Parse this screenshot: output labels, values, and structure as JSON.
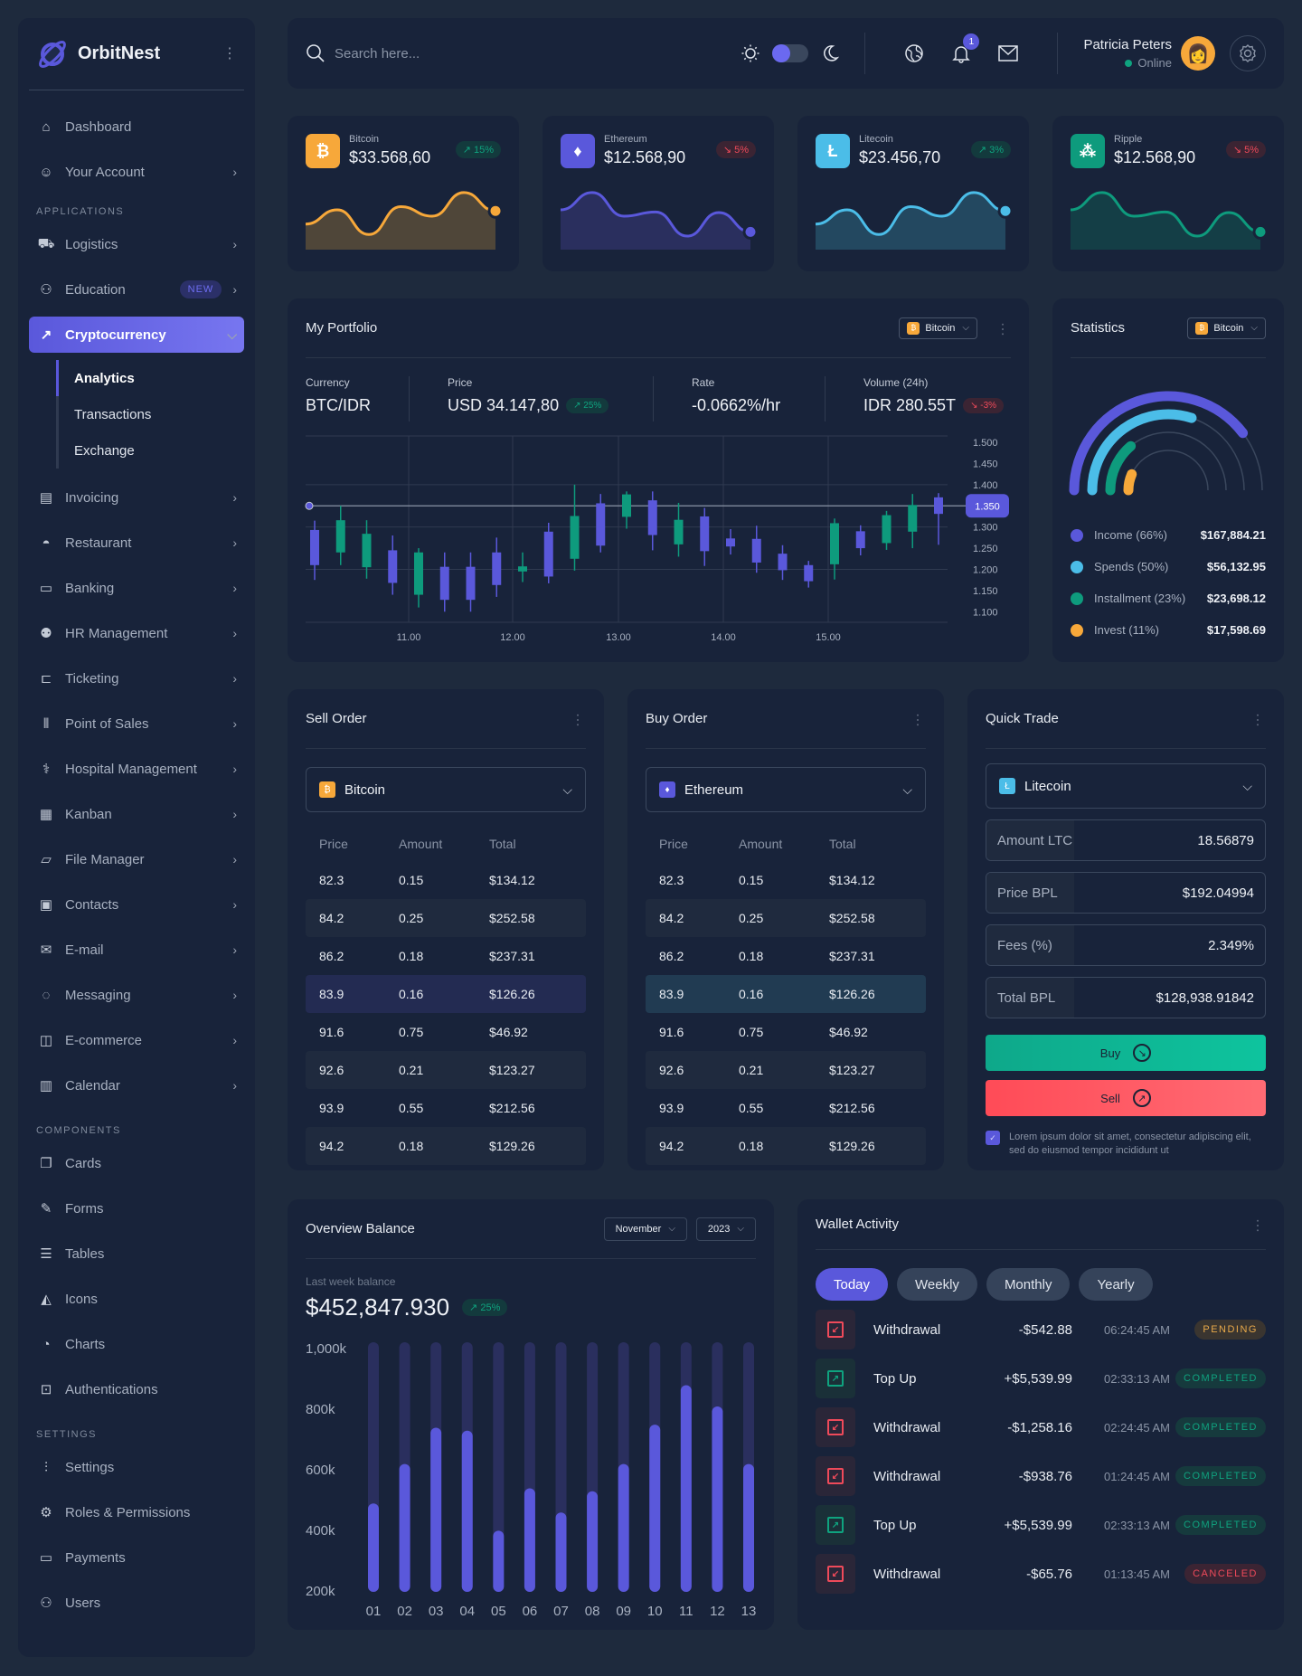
{
  "brand": {
    "name": "OrbitNest"
  },
  "sidebar": {
    "top_items": [
      {
        "label": "Dashboard",
        "icon": "home-icon"
      },
      {
        "label": "Your Account",
        "icon": "user-circle-icon"
      }
    ],
    "sections": {
      "applications": "APPLICATIONS",
      "components": "COMPONENTS",
      "settings": "SETTINGS"
    },
    "applications": [
      {
        "label": "Logistics",
        "icon": "truck-icon"
      },
      {
        "label": "Education",
        "icon": "graduate-icon",
        "badge": "NEW"
      },
      {
        "label": "Cryptocurrency",
        "icon": "trending-up-icon",
        "active": true
      },
      {
        "label": "Invoicing",
        "icon": "invoice-icon"
      },
      {
        "label": "Restaurant",
        "icon": "bowl-icon"
      },
      {
        "label": "Banking",
        "icon": "banknote-icon"
      },
      {
        "label": "HR Management",
        "icon": "users-group-icon"
      },
      {
        "label": "Ticketing",
        "icon": "ticket-icon"
      },
      {
        "label": "Point of Sales",
        "icon": "barcode-icon"
      },
      {
        "label": "Hospital Management",
        "icon": "stethoscope-icon"
      },
      {
        "label": "Kanban",
        "icon": "kanban-icon"
      },
      {
        "label": "File Manager",
        "icon": "folder-icon"
      },
      {
        "label": "Contacts",
        "icon": "contacts-icon"
      },
      {
        "label": "E-mail",
        "icon": "mail-icon"
      },
      {
        "label": "Messaging",
        "icon": "chat-icon"
      },
      {
        "label": "E-commerce",
        "icon": "shop-icon"
      },
      {
        "label": "Calendar",
        "icon": "calendar-icon"
      }
    ],
    "crypto_sub": [
      "Analytics",
      "Transactions",
      "Exchange"
    ],
    "components": [
      {
        "label": "Cards",
        "icon": "cards-icon"
      },
      {
        "label": "Forms",
        "icon": "edit-icon"
      },
      {
        "label": "Tables",
        "icon": "table-icon"
      },
      {
        "label": "Icons",
        "icon": "swatch-icon"
      },
      {
        "label": "Charts",
        "icon": "pie-icon"
      },
      {
        "label": "Authentications",
        "icon": "lock-icon"
      }
    ],
    "settings": [
      {
        "label": "Settings",
        "icon": "sliders-icon"
      },
      {
        "label": "Roles & Permissions",
        "icon": "gear-icon"
      },
      {
        "label": "Payments",
        "icon": "wallet-icon"
      },
      {
        "label": "Users",
        "icon": "users-icon"
      }
    ]
  },
  "topbar": {
    "search_placeholder": "Search here...",
    "notification_count": "1",
    "user_name": "Patricia Peters",
    "user_status": "Online"
  },
  "coins": [
    {
      "name": "Bitcoin",
      "price": "$33.568,60",
      "change": "15%",
      "dir": "up",
      "color": "#f7a83a",
      "fill": "#4f4639",
      "glyph": "₿",
      "spark": [
        0.35,
        0.62,
        0.15,
        0.68,
        0.5,
        0.95,
        0.6
      ]
    },
    {
      "name": "Ethereum",
      "price": "$12.568,90",
      "change": "5%",
      "dir": "down",
      "color": "#5a58db",
      "fill": "#2a2f5e",
      "glyph": "♦",
      "spark": [
        0.62,
        0.95,
        0.5,
        0.58,
        0.12,
        0.57,
        0.2
      ]
    },
    {
      "name": "Litecoin",
      "price": "$23.456,70",
      "change": "3%",
      "dir": "up",
      "color": "#4bbde8",
      "fill": "#234860",
      "glyph": "Ł",
      "spark": [
        0.35,
        0.62,
        0.15,
        0.68,
        0.5,
        0.95,
        0.6
      ]
    },
    {
      "name": "Ripple",
      "price": "$12.568,90",
      "change": "5%",
      "dir": "down",
      "color": "#0e9b7d",
      "fill": "#143e46",
      "glyph": "⁂",
      "spark": [
        0.62,
        0.95,
        0.5,
        0.58,
        0.12,
        0.57,
        0.2
      ]
    }
  ],
  "portfolio": {
    "title": "My Portfolio",
    "coin": "Bitcoin",
    "stats": [
      {
        "label": "Currency",
        "value": "BTC/IDR"
      },
      {
        "label": "Price",
        "value": "USD 34.147,80",
        "change": "25%",
        "dir": "up"
      },
      {
        "label": "Rate",
        "value": "-0.0662%/hr"
      },
      {
        "label": "Volume (24h)",
        "value": "IDR 280.55T",
        "change": "-3%",
        "dir": "down"
      }
    ]
  },
  "statistics": {
    "title": "Statistics",
    "coin": "Bitcoin",
    "items": [
      {
        "label": "Income (66%)",
        "value": "$167,884.21",
        "pct": 66,
        "color": "#5a58db"
      },
      {
        "label": "Spends (50%)",
        "value": "$56,132.95",
        "pct": 50,
        "color": "#4bbde8"
      },
      {
        "label": "Installment (23%)",
        "value": "$23,698.12",
        "pct": 23,
        "color": "#0e9b7d"
      },
      {
        "label": "Invest (11%)",
        "value": "$17,598.69",
        "pct": 11,
        "color": "#f7a83a"
      }
    ]
  },
  "sell_order": {
    "title": "Sell Order",
    "coin": "Bitcoin"
  },
  "buy_order": {
    "title": "Buy Order",
    "coin": "Ethereum"
  },
  "order_headers": [
    "Price",
    "Amount",
    "Total"
  ],
  "order_rows": [
    [
      "82.3",
      "0.15",
      "$134.12"
    ],
    [
      "84.2",
      "0.25",
      "$252.58"
    ],
    [
      "86.2",
      "0.18",
      "$237.31"
    ],
    [
      "83.9",
      "0.16",
      "$126.26"
    ],
    [
      "91.6",
      "0.75",
      "$46.92"
    ],
    [
      "92.6",
      "0.21",
      "$123.27"
    ],
    [
      "93.9",
      "0.55",
      "$212.56"
    ],
    [
      "94.2",
      "0.18",
      "$129.26"
    ]
  ],
  "quick_trade": {
    "title": "Quick Trade",
    "coin": "Litecoin",
    "fields": [
      {
        "label": "Amount LTC",
        "value": "18.56879"
      },
      {
        "label": "Price BPL",
        "value": "$192.04994"
      },
      {
        "label": "Fees (%)",
        "value": "2.349%"
      },
      {
        "label": "Total BPL",
        "value": "$128,938.91842"
      }
    ],
    "buy_label": "Buy",
    "sell_label": "Sell",
    "agree_text": "Lorem ipsum dolor sit amet, consectetur adipiscing elit, sed do eiusmod tempor incididunt ut",
    "agree_checked": true
  },
  "overview": {
    "title": "Overview Balance",
    "month": "November",
    "year": "2023",
    "sub": "Last week balance",
    "balance": "$452,847.930",
    "change": "25%"
  },
  "wallet": {
    "title": "Wallet Activity",
    "tabs": [
      "Today",
      "Weekly",
      "Monthly",
      "Yearly"
    ],
    "rows": [
      {
        "type": "Withdrawal",
        "amount": "-$542.88",
        "time": "06:24:45 AM",
        "status": "PENDING",
        "dir": "out",
        "st": "pending"
      },
      {
        "type": "Top Up",
        "amount": "+$5,539.99",
        "time": "02:33:13 AM",
        "status": "COMPLETED",
        "dir": "in",
        "st": "completed"
      },
      {
        "type": "Withdrawal",
        "amount": "-$1,258.16",
        "time": "02:24:45 AM",
        "status": "COMPLETED",
        "dir": "out",
        "st": "completed"
      },
      {
        "type": "Withdrawal",
        "amount": "-$938.76",
        "time": "01:24:45 AM",
        "status": "COMPLETED",
        "dir": "out",
        "st": "completed"
      },
      {
        "type": "Top Up",
        "amount": "+$5,539.99",
        "time": "02:33:13 AM",
        "status": "COMPLETED",
        "dir": "in",
        "st": "completed"
      },
      {
        "type": "Withdrawal",
        "amount": "-$65.76",
        "time": "01:13:45 AM",
        "status": "CANCELED",
        "dir": "out",
        "st": "canceled"
      }
    ]
  },
  "chart_data": [
    {
      "type": "candlestick",
      "title": "My Portfolio",
      "x_ticks": [
        "11.00",
        "12.00",
        "13.00",
        "14.00",
        "15.00"
      ],
      "y_ticks": [
        "1.500",
        "1.450",
        "1.400",
        "1.350",
        "1.300",
        "1.250",
        "1.200",
        "1.150",
        "1.100"
      ],
      "ylim": [
        1.075,
        1.515
      ],
      "current_price": "1.350",
      "current_value": 1.35,
      "up_color": "#0e9b7d",
      "down_color": "#5a58db",
      "candles": [
        {
          "o": 1.293,
          "c": 1.21,
          "h": 1.315,
          "l": 1.175
        },
        {
          "o": 1.24,
          "c": 1.316,
          "h": 1.35,
          "l": 1.21
        },
        {
          "o": 1.205,
          "c": 1.284,
          "h": 1.316,
          "l": 1.178
        },
        {
          "o": 1.245,
          "c": 1.168,
          "h": 1.28,
          "l": 1.14
        },
        {
          "o": 1.14,
          "c": 1.24,
          "h": 1.25,
          "l": 1.11
        },
        {
          "o": 1.206,
          "c": 1.128,
          "h": 1.24,
          "l": 1.1
        },
        {
          "o": 1.206,
          "c": 1.128,
          "h": 1.24,
          "l": 1.1
        },
        {
          "o": 1.24,
          "c": 1.163,
          "h": 1.275,
          "l": 1.135
        },
        {
          "o": 1.195,
          "c": 1.207,
          "h": 1.24,
          "l": 1.17
        },
        {
          "o": 1.289,
          "c": 1.183,
          "h": 1.31,
          "l": 1.167
        },
        {
          "o": 1.225,
          "c": 1.326,
          "h": 1.4,
          "l": 1.197
        },
        {
          "o": 1.356,
          "c": 1.256,
          "h": 1.378,
          "l": 1.24
        },
        {
          "o": 1.324,
          "c": 1.377,
          "h": 1.384,
          "l": 1.296
        },
        {
          "o": 1.363,
          "c": 1.281,
          "h": 1.384,
          "l": 1.245
        },
        {
          "o": 1.259,
          "c": 1.317,
          "h": 1.357,
          "l": 1.23
        },
        {
          "o": 1.325,
          "c": 1.243,
          "h": 1.345,
          "l": 1.208
        },
        {
          "o": 1.273,
          "c": 1.254,
          "h": 1.295,
          "l": 1.235
        },
        {
          "o": 1.272,
          "c": 1.216,
          "h": 1.303,
          "l": 1.192
        },
        {
          "o": 1.237,
          "c": 1.198,
          "h": 1.257,
          "l": 1.175
        },
        {
          "o": 1.21,
          "c": 1.172,
          "h": 1.22,
          "l": 1.157
        },
        {
          "o": 1.212,
          "c": 1.309,
          "h": 1.32,
          "l": 1.176
        },
        {
          "o": 1.29,
          "c": 1.25,
          "h": 1.304,
          "l": 1.233
        },
        {
          "o": 1.262,
          "c": 1.328,
          "h": 1.338,
          "l": 1.246
        },
        {
          "o": 1.289,
          "c": 1.352,
          "h": 1.378,
          "l": 1.25
        },
        {
          "o": 1.37,
          "c": 1.331,
          "h": 1.38,
          "l": 1.258
        }
      ]
    },
    {
      "type": "radial-bar",
      "title": "Statistics",
      "series": [
        {
          "name": "Income",
          "value": 66
        },
        {
          "name": "Spends",
          "value": 50
        },
        {
          "name": "Installment",
          "value": 23
        },
        {
          "name": "Invest",
          "value": 11
        }
      ],
      "unit": "%"
    },
    {
      "type": "bar",
      "title": "Overview Balance",
      "categories": [
        "01",
        "02",
        "03",
        "04",
        "05",
        "06",
        "07",
        "08",
        "09",
        "10",
        "11",
        "12",
        "13"
      ],
      "values": [
        480,
        610,
        730,
        720,
        390,
        530,
        450,
        520,
        610,
        740,
        870,
        800,
        610
      ],
      "y_ticks": [
        "1,000k",
        "800k",
        "600k",
        "400k",
        "200k"
      ],
      "ylim": [
        200,
        1000
      ],
      "unit": "k",
      "color": "#5a58db",
      "track_color": "#2a2f5e"
    }
  ]
}
